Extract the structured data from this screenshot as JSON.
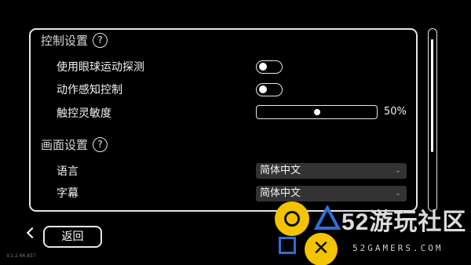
{
  "settings": {
    "control_section": {
      "title": "控制设置",
      "help_glyph": "?",
      "rows": [
        {
          "label": "使用眼球运动探测",
          "control": "toggle",
          "on": false
        },
        {
          "label": "动作感知控制",
          "control": "toggle",
          "on": false
        },
        {
          "label": "触控灵敏度",
          "control": "slider",
          "value": 50,
          "value_label": "50%"
        }
      ]
    },
    "display_section": {
      "title": "画面设置",
      "help_glyph": "?",
      "rows": [
        {
          "label": "语言",
          "control": "select",
          "selected": "简体中文"
        },
        {
          "label": "字幕",
          "control": "select",
          "selected": "简体中文"
        }
      ]
    }
  },
  "footer": {
    "back_label": "返回",
    "version": "V.1.2.66.837"
  },
  "watermark": {
    "text": "52游玩社区",
    "subtext": "52GAMERS.COM",
    "x_glyph": "✕",
    "colors": {
      "yellow": "#f4c300",
      "blue": "#2f6fd6"
    }
  },
  "colors": {
    "background": "#000000",
    "outline": "#e6e6e6",
    "select_bg": "#333333"
  }
}
